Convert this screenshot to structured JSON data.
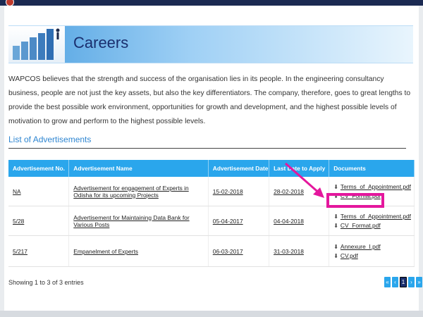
{
  "banner": {
    "title": "Careers"
  },
  "intro": "WAPCOS believes that the strength and success of the organisation lies in its people. In the engineering consultancy business, people are not just the key assets, but also the key differentiators. The company, therefore, goes to great lengths to provide the best possible work environment, opportunities for growth and development, and the highest possible levels of motivation to grow and perform to the highest possible levels.",
  "section_title": "List of Advertisements",
  "table": {
    "headers": [
      "Advertisement No.",
      "Advertisement Name",
      "Advertisement Date",
      "Last Date to Apply",
      "Documents"
    ],
    "rows": [
      {
        "no": "NA",
        "name": "Advertisement for engagement of Experts in Odisha for its upcoming Projects",
        "date": "15-02-2018",
        "last_date": "28-02-2018",
        "docs": [
          "Terms_of_Appointment.pdf",
          "CV_Format.pdf"
        ]
      },
      {
        "no": "5/28",
        "name": "Advertisement for Maintaining Data Bank for Various Posts",
        "date": "05-04-2017",
        "last_date": "04-04-2018",
        "docs": [
          "Terms_of_Appointment.pdf",
          "CV_Format.pdf"
        ]
      },
      {
        "no": "5/217",
        "name": "Empanelment of Experts",
        "date": "06-03-2017",
        "last_date": "31-03-2018",
        "docs": [
          "Annexure_I.pdf",
          "CV.pdf"
        ]
      }
    ]
  },
  "footer": {
    "showing": "Showing 1 to 3 of 3 entries",
    "pager": {
      "first": "«",
      "prev": "‹",
      "current": "1",
      "next": "›",
      "last": "»"
    }
  },
  "icons": {
    "download": "download-icon"
  },
  "colors": {
    "header_blue": "#2aa6ec",
    "annotation": "#e4179d",
    "title_navy": "#1a2f6e"
  }
}
